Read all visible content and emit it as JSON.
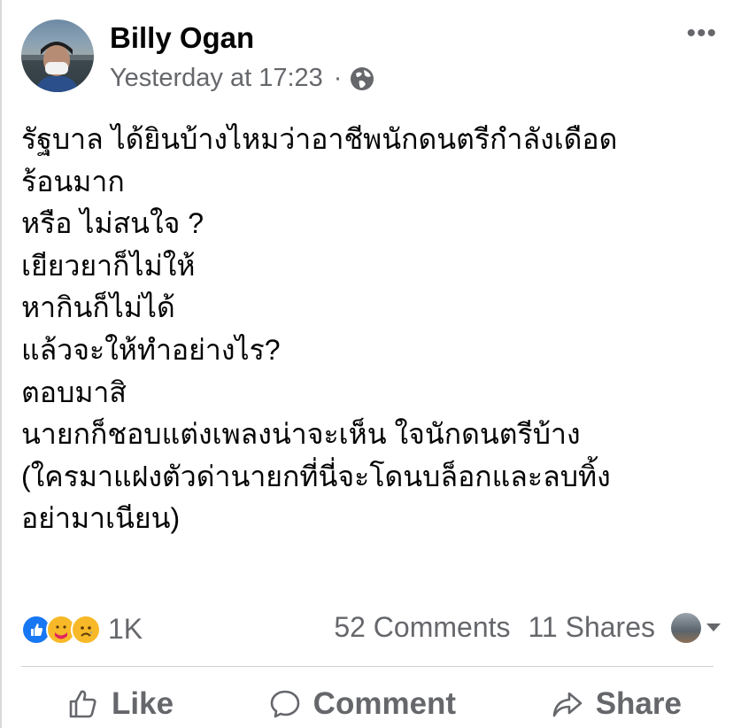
{
  "post": {
    "author": "Billy Ogan",
    "timestamp": "Yesterday at 17:23",
    "separator": "·",
    "privacy_icon": "globe-icon",
    "more_label": "•••",
    "text_lines": [
      "รัฐบาล ได้ยินบ้างไหมว่าอาชีพนักดนตรีกำลังเดือด",
      "ร้อนมาก",
      "หรือ ไม่สนใจ ?",
      "เยียวยาก็ไม่ให้",
      "หากินก็ไม่ได้",
      "แล้วจะให้ทำอย่างไร?",
      "ตอบมาสิ",
      "นายกก็ชอบแต่งเพลงน่าจะเห็น ใจนักดนตรีบ้าง",
      "(ใครมาแฝงตัวด่านายกที่นี่จะโดนบล็อกและลบทิ้ง",
      "อย่ามาเนียน)"
    ]
  },
  "stats": {
    "reaction_icons": [
      "like-reaction-icon",
      "care-reaction-icon",
      "sad-reaction-icon"
    ],
    "reaction_count": "1K",
    "comments": "52 Comments",
    "shares": "11 Shares"
  },
  "actions": {
    "like": "Like",
    "comment": "Comment",
    "share": "Share"
  },
  "colors": {
    "text": "#050505",
    "secondary": "#65676b",
    "like_blue": "#1877f2",
    "reaction_yellow": "#f7b928",
    "divider": "#ced0d4"
  }
}
